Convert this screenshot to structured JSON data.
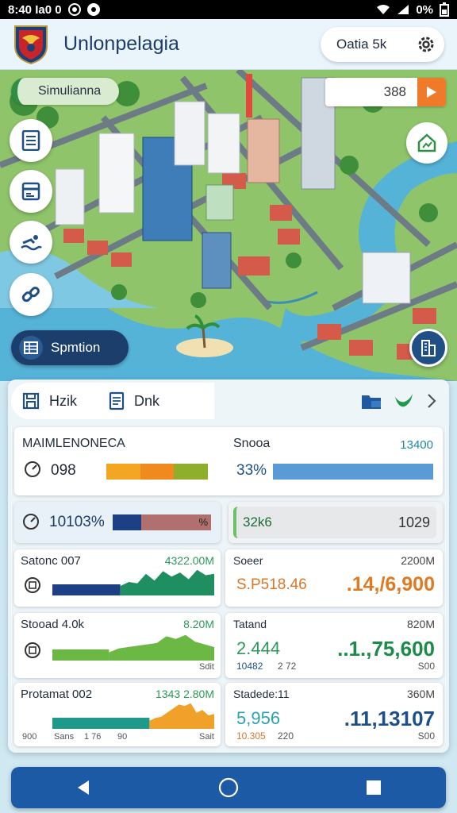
{
  "status_bar": {
    "time_text": "8:40 Ia0 0",
    "battery": "0%"
  },
  "app": {
    "title": "Unlonpelagia",
    "pill_label": "Oatia 5k"
  },
  "map": {
    "sim_label": "Simulianna",
    "score_value": "388",
    "spm_label": "Spmtion",
    "icons": [
      "document-icon",
      "credit-card-icon",
      "swim-icon",
      "link-icon",
      "home-growth-icon",
      "building-icon",
      "table-icon"
    ]
  },
  "tabs": {
    "tab1": "Hzik",
    "tab2": "Dnk"
  },
  "metric_top": {
    "left_title": "MAIMLENONECA",
    "left_value": "098",
    "right_title": "Snooa",
    "right_value": "13400",
    "right_pct": "33%",
    "left_bar_fraction": 0.9,
    "right_bar_fraction": 1.0,
    "left_bar_colors": [
      "#f2a621",
      "#f08a1f",
      "#8fae2c"
    ],
    "right_bar_color": "#5b9bd5"
  },
  "metric_second": {
    "left_value": "10103%",
    "left_badge": "%",
    "right_left": "32k6",
    "right_value": "1029",
    "right_bar_fraction": 1.0
  },
  "rows": [
    {
      "title": "Satonc 007",
      "amount": "4322.00M",
      "right_title": "Soeer",
      "right_amount": "2200M",
      "right_small": "S.P518.46",
      "right_big": ".14,/6,900",
      "big_color": "#e07a22",
      "small_color": "#d9772a",
      "bar_color": "#1d3f84",
      "spark_color": "#1f8f62",
      "sub_left": "",
      "sub_mid": "",
      "sub_right": "",
      "sub_mid2": "",
      "left_bar_fraction": 0.42,
      "sparkline": [
        0.35,
        0.5,
        0.45,
        0.8,
        0.55,
        0.9,
        0.7,
        0.85,
        0.6,
        0.95,
        0.75,
        0.8
      ]
    },
    {
      "title": "Stooad 4.0k",
      "amount": "8.20M",
      "right_title": "Tatand",
      "right_amount": "820M",
      "right_small": "2.444",
      "right_sub": "10482",
      "right_sub2": "2 72",
      "right_big": "..1.,75,600",
      "right_foot": "S00",
      "big_color": "#1e8a4a",
      "small_color": "#2e9a5a",
      "bar_color": "#6cb844",
      "spark_color": "#6cb844",
      "sub_right": "Sdit",
      "left_bar_fraction": 0.35,
      "sparkline": [
        0.3,
        0.45,
        0.5,
        0.55,
        0.6,
        0.65,
        0.9,
        0.8,
        0.95,
        0.7,
        0.6,
        0.5
      ]
    },
    {
      "title": "Protamat 002",
      "amount": "1343 2.80M",
      "right_title": "Stadede:11",
      "right_amount": "360M",
      "right_small": "5,956",
      "right_sub": "10.305",
      "right_sub2": "220",
      "right_big": ".11,13107",
      "right_foot": "S00",
      "big_color": "#1d4f8a",
      "small_color": "#2aa5b2",
      "bar_color": "#1f9a8a",
      "spark_color": "#f0a12a",
      "sub_left": "900",
      "sub_mid": "Sans",
      "sub_mid2": "1 76",
      "sub_mid3": "90",
      "sub_right": "Sait",
      "left_bar_fraction": 0.6,
      "sparkline": [
        0.3,
        0.4,
        0.45,
        0.6,
        0.75,
        0.9,
        0.85,
        0.95,
        0.6,
        0.7,
        0.5,
        0.55
      ]
    }
  ],
  "colors": {
    "accent": "#1d5aa6",
    "orange": "#ef7a2a",
    "green": "#2f8f46"
  }
}
